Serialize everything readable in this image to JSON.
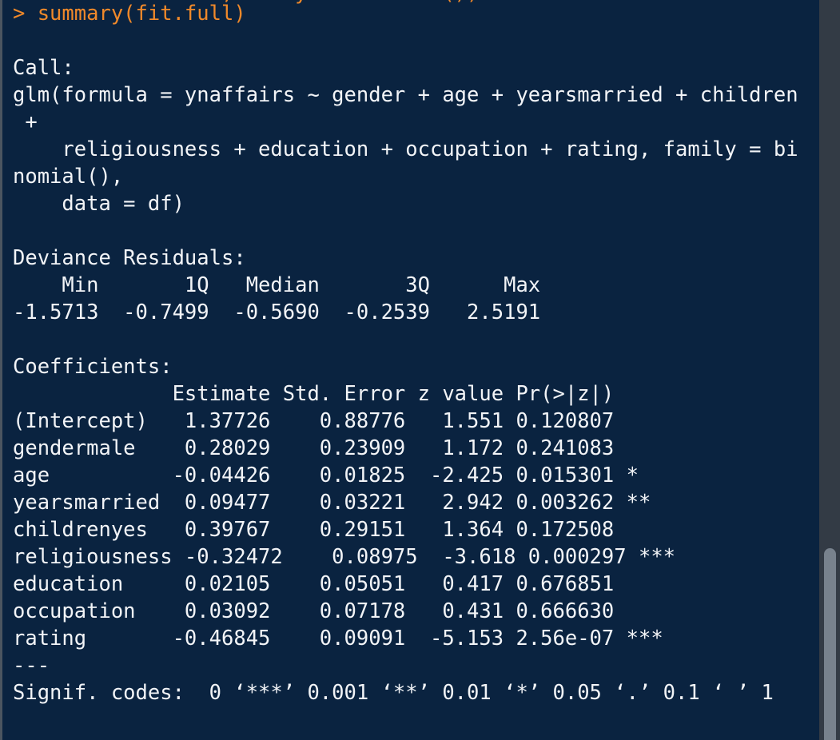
{
  "window": {
    "title": "R Console",
    "background_color": "#0a2340",
    "text_color": "#f2f4f7",
    "prompt_color": "#f0892a",
    "gutter_color": "#333b45",
    "scrollbar_thumb_color": "#78828d"
  },
  "console": {
    "clipped_top_line": "          data=df,family = binomial())",
    "prompt_line": "> summary(fit.full)",
    "blank_1": "",
    "call_heading": "Call:",
    "call_line_1": "glm(formula = ynaffairs ~ gender + age + yearsmarried + children",
    "call_line_2": " +",
    "call_line_3": "    religiousness + education + occupation + rating, family = bi",
    "call_line_4": "nomial(),",
    "call_line_5": "    data = df)",
    "blank_2": "",
    "deviance_heading": "Deviance Residuals:",
    "deviance_header_row": "    Min       1Q   Median       3Q      Max  ",
    "deviance_value_row": "-1.5713  -0.7499  -0.5690  -0.2539   2.5191  ",
    "blank_3": "",
    "coefficients_heading": "Coefficients:",
    "coefficients_header_row": "             Estimate Std. Error z value Pr(>|z|)    ",
    "coef_intercept": "(Intercept)   1.37726    0.88776   1.551 0.120807    ",
    "coef_gendermale": "gendermale    0.28029    0.23909   1.172 0.241083    ",
    "coef_age": "age          -0.04426    0.01825  -2.425 0.015301 *  ",
    "coef_yearsmarried": "yearsmarried  0.09477    0.03221   2.942 0.003262 ** ",
    "coef_childrenyes": "childrenyes   0.39767    0.29151   1.364 0.172508    ",
    "coef_religiousness": "religiousness -0.32472    0.08975  -3.618 0.000297 ***",
    "coef_education": "education     0.02105    0.05051   0.417 0.676851    ",
    "coef_occupation": "occupation    0.03092    0.07178   0.431 0.666630    ",
    "coef_rating": "rating       -0.46845    0.09091  -5.153 2.56e-07 ***",
    "separator": "---",
    "signif_codes": "Signif. codes:  0 ‘***’ 0.001 ‘**’ 0.01 ‘*’ 0.05 ‘.’ 0.1 ‘ ’ 1"
  },
  "coefficients_table": {
    "columns": [
      "",
      "Estimate",
      "Std. Error",
      "z value",
      "Pr(>|z|)",
      ""
    ],
    "rows": [
      [
        "(Intercept)",
        "1.37726",
        "0.88776",
        "1.551",
        "0.120807",
        ""
      ],
      [
        "gendermale",
        "0.28029",
        "0.23909",
        "1.172",
        "0.241083",
        ""
      ],
      [
        "age",
        "-0.04426",
        "0.01825",
        "-2.425",
        "0.015301",
        "*"
      ],
      [
        "yearsmarried",
        "0.09477",
        "0.03221",
        "2.942",
        "0.003262",
        "**"
      ],
      [
        "childrenyes",
        "0.39767",
        "0.29151",
        "1.364",
        "0.172508",
        ""
      ],
      [
        "religiousness",
        "-0.32472",
        "0.08975",
        "-3.618",
        "0.000297",
        "***"
      ],
      [
        "education",
        "0.02105",
        "0.05051",
        "0.417",
        "0.676851",
        ""
      ],
      [
        "occupation",
        "0.03092",
        "0.07178",
        "0.431",
        "0.666630",
        ""
      ],
      [
        "rating",
        "-0.46845",
        "0.09091",
        "-5.153",
        "2.56e-07",
        "***"
      ]
    ]
  },
  "deviance_residuals": {
    "labels": [
      "Min",
      "1Q",
      "Median",
      "3Q",
      "Max"
    ],
    "values": [
      "-1.5713",
      "-0.7499",
      "-0.5690",
      "-0.2539",
      "2.5191"
    ]
  }
}
